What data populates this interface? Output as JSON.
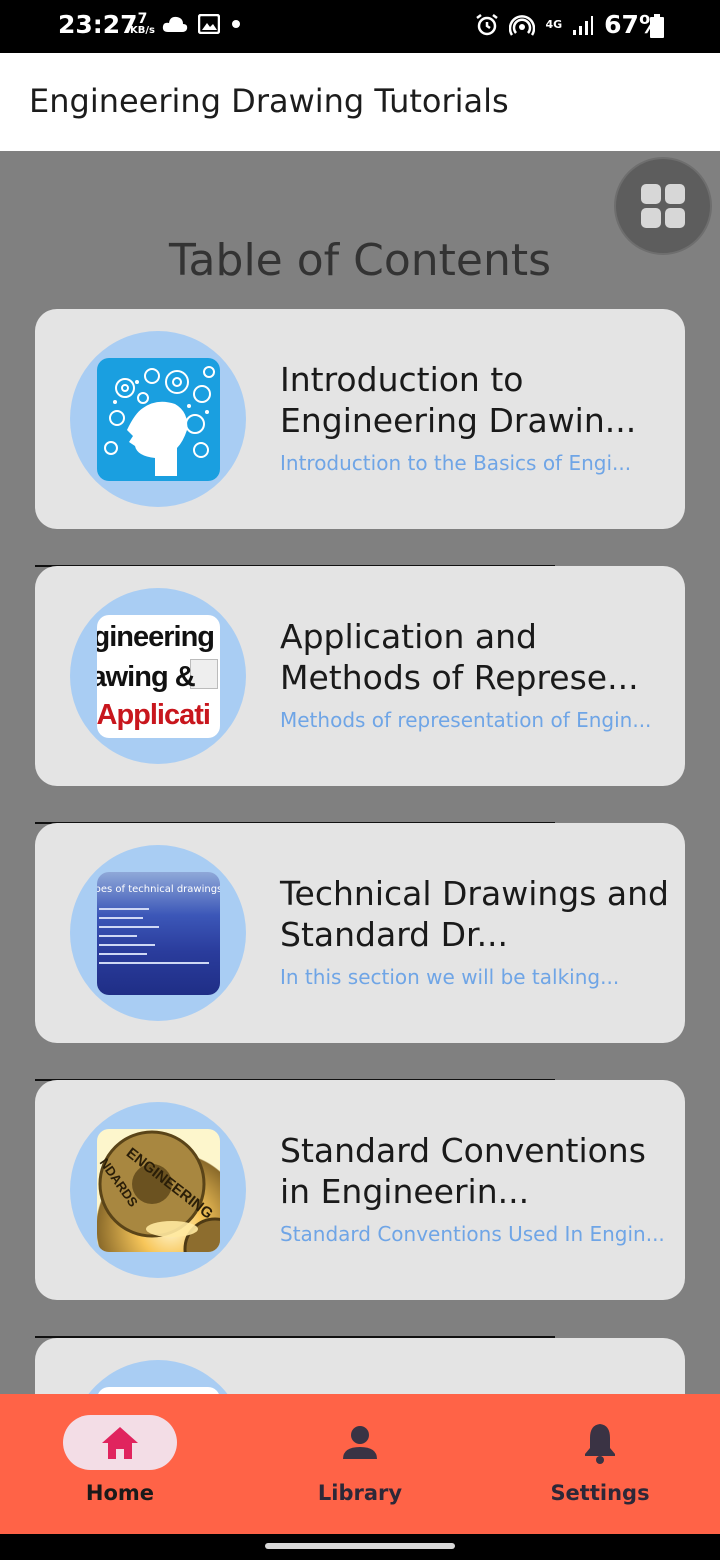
{
  "status_bar": {
    "time": "23:27",
    "speed_value": "7",
    "speed_unit": "KB/s",
    "network": "4G",
    "battery": "67%"
  },
  "header": {
    "title": "Engineering Drawing Tutorials"
  },
  "main": {
    "title": "Table of Contents",
    "items": [
      {
        "title": "Introduction to Engineering Drawin...",
        "subtitle": "Introduction to the Basics of Engi..."
      },
      {
        "title": "Application and Methods of Represe...",
        "subtitle": "Methods of representation of Engin...",
        "thumb_lines": [
          "gineering",
          "awing &",
          "Applicati"
        ]
      },
      {
        "title": "Technical Drawings and Standard Dr...",
        "subtitle": "In this section we will be talking...",
        "thumb_heading": "pes of technical drawings"
      },
      {
        "title": "Standard Conventions in Engineerin...",
        "subtitle": "Standard Conventions Used In Engin...",
        "thumb_text_1": "ENGINEERING",
        "thumb_text_2": "NDARDS"
      }
    ]
  },
  "bottom_nav": {
    "items": [
      {
        "label": "Home",
        "icon": "home-icon",
        "active": true
      },
      {
        "label": "Library",
        "icon": "person-icon",
        "active": false
      },
      {
        "label": "Settings",
        "icon": "bell-icon",
        "active": false
      }
    ]
  },
  "colors": {
    "accent_nav": "#ff6347",
    "active_icon": "#e0245e",
    "subtitle": "#6fa5e6",
    "thumb_ring": "#a9cdf3",
    "content_bg": "#808080"
  }
}
